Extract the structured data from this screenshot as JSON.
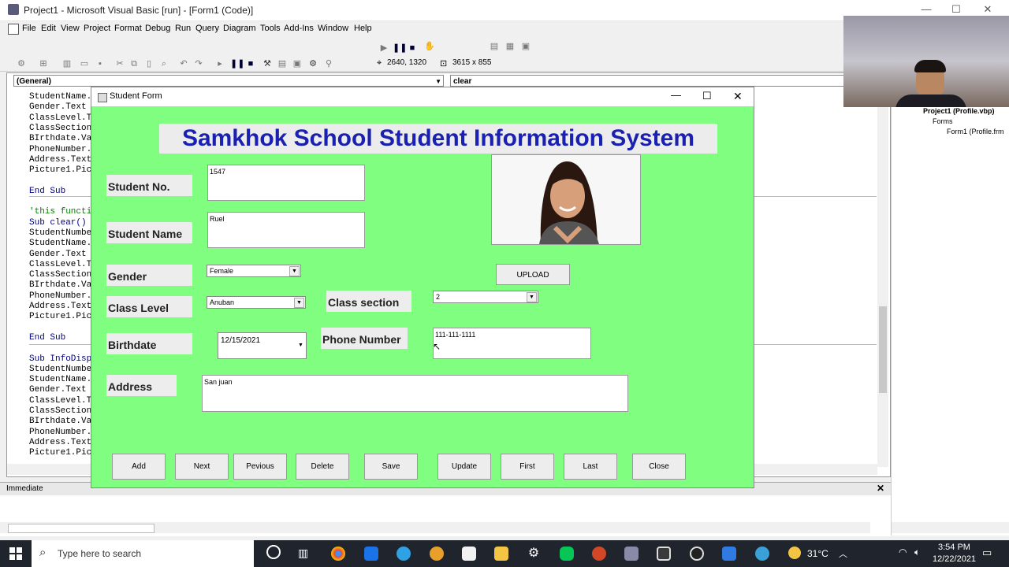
{
  "ide": {
    "title": "Project1 - Microsoft Visual Basic [run] - [Form1 (Code)]",
    "menu": [
      "File",
      "Edit",
      "View",
      "Project",
      "Format",
      "Debug",
      "Run",
      "Query",
      "Diagram",
      "Tools",
      "Add-Ins",
      "Window",
      "Help"
    ],
    "position_readout": "2640, 1320",
    "size_readout": "3615 x 855",
    "object_combo": "(General)",
    "procedure_combo": "clear",
    "code_lines": [
      "StudentName.",
      "Gender.Text",
      "ClassLevel.T",
      "ClassSection",
      "BIrthdate.Va",
      "PhoneNumber.",
      "Address.Text",
      "Picture1.Pic",
      "",
      "End Sub",
      "",
      "'this functi",
      "Sub clear()",
      "StudentNumbe",
      "StudentName.",
      "Gender.Text",
      "ClassLevel.T",
      "ClassSection",
      "BIrthdate.Va",
      "PhoneNumber.",
      "Address.Text",
      "Picture1.Pic",
      "",
      "End Sub",
      "",
      "Sub InfoDisp",
      "StudentNumbe",
      "StudentName.",
      "Gender.Text",
      "ClassLevel.T",
      "ClassSection",
      "BIrthdate.Va",
      "PhoneNumber.",
      "Address.Text",
      "Picture1.Pic"
    ],
    "immediate_title": "Immediate",
    "project_tree": {
      "root": "Project1 (Profile.vbp)",
      "folder": "Forms",
      "item": "Form1 (Profile.frm"
    }
  },
  "form": {
    "window_title": "Student Form",
    "heading": "Samkhok School Student Information System",
    "labels": {
      "student_no": "Student No.",
      "student_name": "Student Name",
      "gender": "Gender",
      "class_level": "Class Level",
      "class_section": "Class section",
      "birthdate": "Birthdate",
      "phone_number": "Phone Number",
      "address": "Address"
    },
    "values": {
      "student_no": "1547",
      "student_name": "Ruel",
      "gender": "Female",
      "class_level": "Anuban",
      "class_section": "2",
      "birthdate": "12/15/2021",
      "phone_number": "111-111-1111",
      "address": "San juan"
    },
    "upload_label": "UPLOAD",
    "buttons": {
      "add": "Add",
      "next": "Next",
      "previous": "Pevious",
      "delete": "Delete",
      "save": "Save",
      "update": "Update",
      "first": "First",
      "last": "Last",
      "close": "Close"
    }
  },
  "taskbar": {
    "search_placeholder": "Type here to search",
    "temperature": "31°C",
    "time": "3:54 PM",
    "date": "12/22/2021"
  },
  "colors": {
    "form_bg": "#80fe80",
    "heading_text": "#1a20b0",
    "taskbar_bg": "#20242c"
  }
}
